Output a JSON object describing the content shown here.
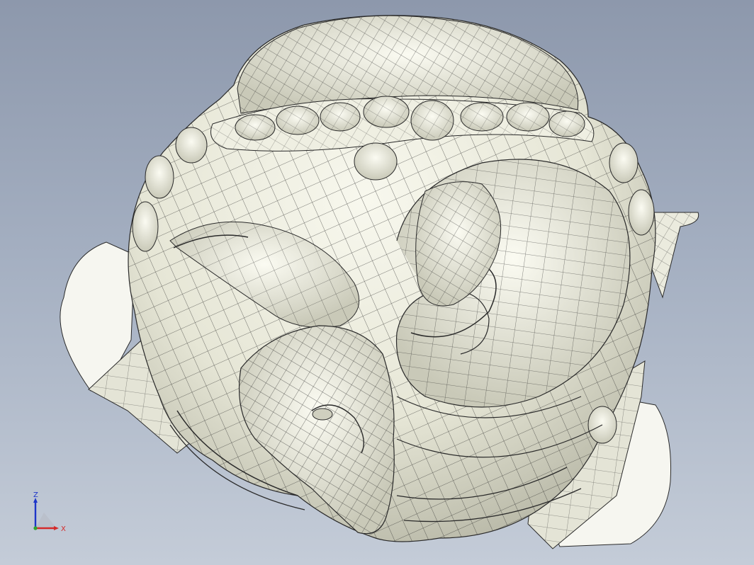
{
  "viewport": {
    "background_top": "#8d98ac",
    "background_bottom": "#c4ccd8",
    "model_color": "#ebebde",
    "mesh_color": "#1e1e1e"
  },
  "triad": {
    "z_label": "Z",
    "x_label": "X",
    "z_color": "#1d35c9",
    "x_color": "#d42a2a"
  }
}
